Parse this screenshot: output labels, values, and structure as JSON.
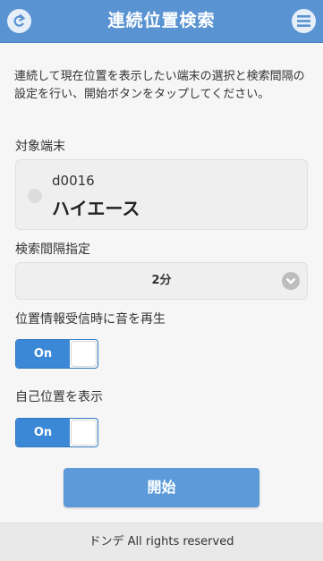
{
  "header": {
    "title": "連続位置検索",
    "back_icon": "back-arrow-icon",
    "menu_icon": "menu-icon"
  },
  "description": "連続して現在位置を表示したい端末の選択と検索間隔の設定を行い、開始ボタンをタップしてください。",
  "target_device": {
    "label": "対象端末",
    "device_id": "d0016",
    "device_name": "ハイエース"
  },
  "interval": {
    "label": "検索間隔指定",
    "selected": "2分"
  },
  "sound": {
    "label": "位置情報受信時に音を再生",
    "state": "On"
  },
  "show_self": {
    "label": "自己位置を表示",
    "state": "On"
  },
  "start_button": {
    "label": "開始"
  },
  "footer": {
    "text": "ドンデ All rights reserved"
  },
  "colors": {
    "header": "#5a93d2",
    "accent": "#3b88d6",
    "button": "#5c9ad9"
  }
}
